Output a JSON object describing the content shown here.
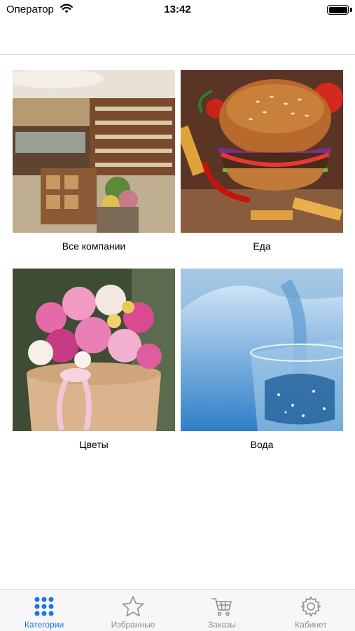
{
  "status": {
    "carrier": "Оператор",
    "time": "13:42"
  },
  "categories": [
    {
      "label": "Все компании",
      "image": "store-interior"
    },
    {
      "label": "Еда",
      "image": "burger"
    },
    {
      "label": "Цветы",
      "image": "flower-bouquet"
    },
    {
      "label": "Вода",
      "image": "water-glass"
    }
  ],
  "tabs": [
    {
      "label": "Категории",
      "icon": "grid-icon",
      "active": true
    },
    {
      "label": "Избранные",
      "icon": "star-icon",
      "active": false
    },
    {
      "label": "Заказы",
      "icon": "cart-icon",
      "active": false
    },
    {
      "label": "Кабинет",
      "icon": "gear-icon",
      "active": false
    }
  ],
  "colors": {
    "accent": "#1a73e8",
    "inactive": "#8e8e93"
  }
}
